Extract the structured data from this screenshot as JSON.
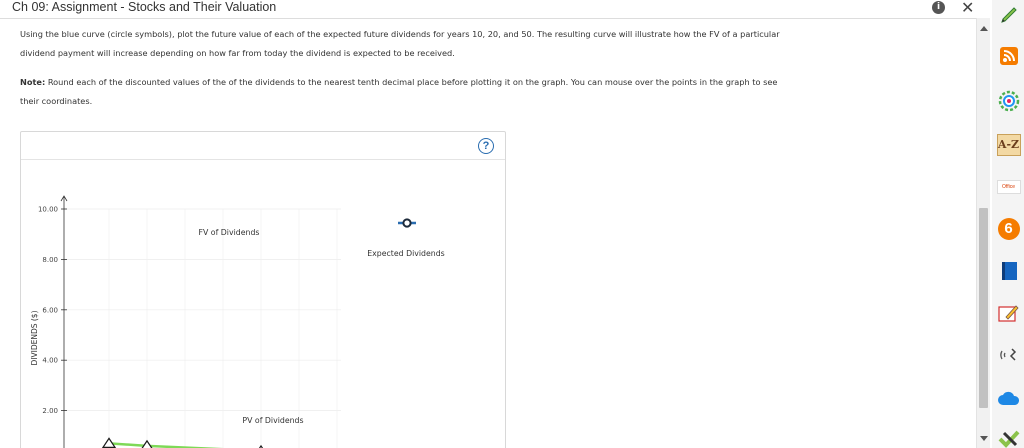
{
  "window": {
    "title": "Ch 09: Assignment - Stocks and Their Valuation"
  },
  "instructions": {
    "paragraph1": "Using the blue curve (circle symbols), plot the future value of each of the expected future dividends for years 10, 20, and 50. The resulting curve will illustrate how the FV of a particular dividend payment will increase depending on how far from today the dividend is expected to be received.",
    "note_label": "Note:",
    "note_text": " Round each of the discounted values of the of the dividends to the nearest tenth decimal place before plotting it on the graph. You can mouse over the points in the graph to see their coordinates."
  },
  "help": {
    "symbol": "?"
  },
  "chart_data": {
    "type": "line",
    "ylabel": "DIVIDENDS ($)",
    "ylim": [
      0,
      10
    ],
    "y_ticks": [
      "2.00",
      "4.00",
      "6.00",
      "8.00",
      "10.00"
    ],
    "annotations": [
      "FV of Dividends",
      "PV of Dividends"
    ],
    "legend": {
      "position": "right",
      "entries": [
        "Expected Dividends"
      ]
    },
    "series": [
      {
        "name": "PV of Dividends",
        "color": "#7ed957",
        "marker": "triangle",
        "x": [
          1,
          2,
          5
        ],
        "y": [
          0.7,
          0.6,
          0.4
        ]
      }
    ]
  },
  "colors": {
    "fv_curve": "#2a6db0",
    "pv_curve": "#7ed957"
  },
  "rail": {
    "icons": [
      "pencil-icon",
      "rss-icon",
      "color-wheel-icon",
      "a-z-icon",
      "office-icon",
      "six-icon",
      "book-icon",
      "note-icon",
      "wifi-tool-icon",
      "cloud-icon",
      "check-icon"
    ],
    "az_label": "A-Z",
    "office_label": "Office",
    "six_label": "6"
  }
}
